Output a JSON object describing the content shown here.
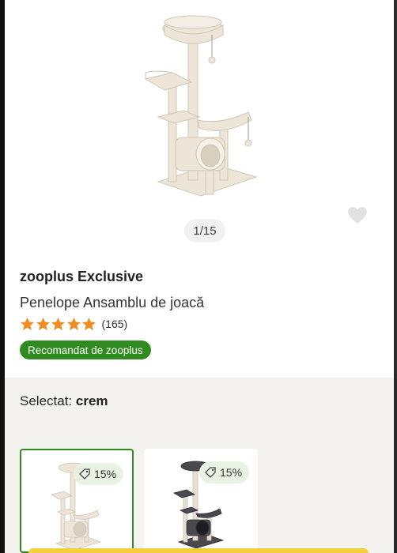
{
  "gallery": {
    "pager": "1/15",
    "favorite_icon": "heart-icon"
  },
  "product": {
    "brand": "zooplus Exclusive",
    "name": "Penelope Ansamblu de joacă",
    "rating": 5,
    "rating_max": 5,
    "review_count": "(165)",
    "badge": "Recomandat de zooplus"
  },
  "variants": {
    "selected_label": "Selectat:",
    "selected_value": "crem",
    "items": [
      {
        "discount": "15%",
        "color": "crem",
        "active": true
      },
      {
        "discount": "15%",
        "color": "dark",
        "active": false
      }
    ]
  },
  "colors": {
    "star": "#f28c1e",
    "badge_green": "#2f8a1f",
    "discount_bg": "#e8f3e3",
    "cta_yellow": "#f4d03f"
  }
}
